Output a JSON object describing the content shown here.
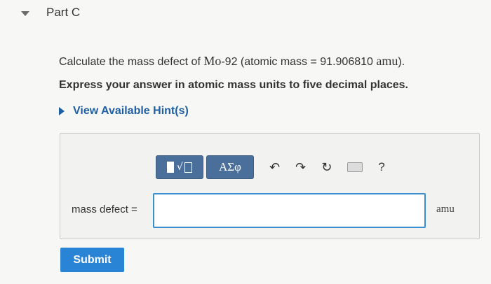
{
  "part": {
    "title": "Part C"
  },
  "question": {
    "prefix": "Calculate the mass defect of ",
    "isotope": "Mo",
    "mid": "-92 (atomic mass = 91.906810 ",
    "unit": "amu",
    "suffix": ")."
  },
  "instruction": "Express your answer in atomic mass units to five decimal places.",
  "hint": {
    "label": "View Available Hint(s)"
  },
  "toolbar": {
    "symbols_label": "ΑΣφ",
    "templates_root": "√",
    "undo_glyph": "↶",
    "redo_glyph": "↷",
    "reset_glyph": "↻",
    "help_label": "?"
  },
  "answer": {
    "label": "mass defect =",
    "value": "",
    "unit": "amu"
  },
  "submit_label": "Submit"
}
